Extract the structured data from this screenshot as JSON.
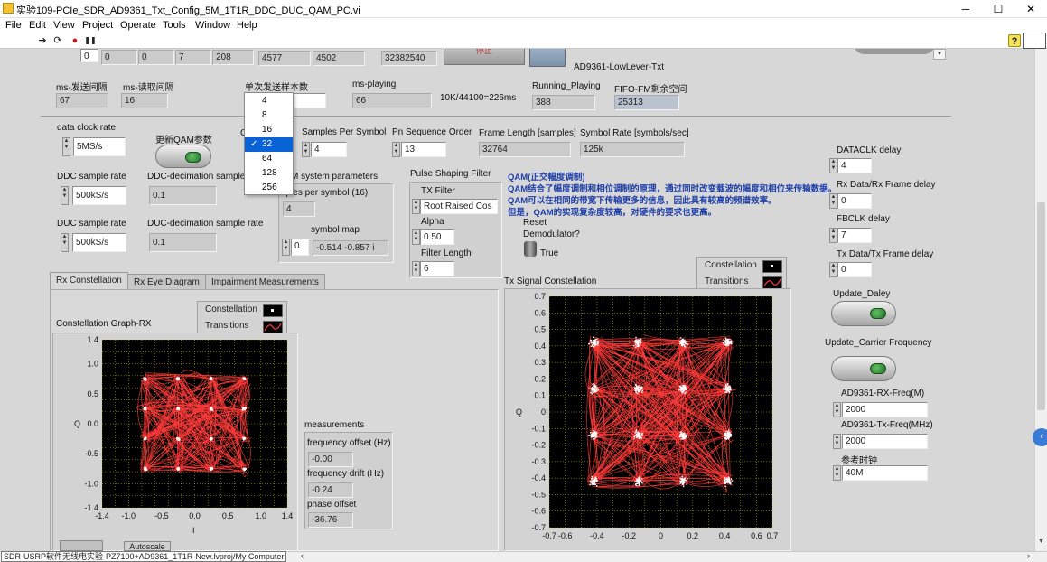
{
  "window": {
    "title": "实验109-PCIe_SDR_AD9361_Txt_Config_5M_1T1R_DDC_DUC_QAM_PC.vi",
    "minimize": "─",
    "maximize": "☐",
    "close": "✕"
  },
  "menu": [
    "File",
    "Edit",
    "View",
    "Project",
    "Operate",
    "Tools",
    "Window",
    "Help"
  ],
  "toolbar": {
    "run": "➔",
    "run_cont": "⟳",
    "abort": "●",
    "pause": "❚❚",
    "help": "?"
  },
  "top_row": {
    "v0": "0",
    "v1": "0",
    "v2": "0",
    "v3": "7",
    "v4": "208",
    "v5": "4577",
    "v6": "4502",
    "v7": "32382540",
    "button_text": "停止",
    "ad_label": "AD9361-LowLever-Txt"
  },
  "row2": {
    "ms_send_label": "ms-发送间隔",
    "ms_send": "67",
    "ms_read_label": "ms-读取间隔",
    "ms_read": "16",
    "single_samples_label": "单次发送样本数",
    "ms_playing_label": "ms-playing",
    "ms_playing": "66",
    "rate_note": "10K/44100=226ms",
    "running_label": "Running_Playing",
    "running": "388",
    "fifo_label": "FIFO-FM剩余空间",
    "fifo": "25313"
  },
  "dropdown": {
    "items": [
      "4",
      "8",
      "16",
      "32",
      "64",
      "128",
      "256"
    ],
    "selected_index": 3
  },
  "left": {
    "data_clock_label": "data clock rate",
    "data_clock": "5MS/s",
    "update_qam_label": "更新QAM参数",
    "ddc_label": "DDC sample rate",
    "ddc": "500kS/s",
    "ddc_dec_label": "DDC-decimation sample rate",
    "ddc_dec": "0.1",
    "duc_label": "DUC sample rate",
    "duc": "500kS/s",
    "duc_dec_label": "DUC-decimation sample rate",
    "duc_dec": "0.1",
    "c_fragment": "C"
  },
  "qam_params": {
    "sps_label": "Samples Per Symbol",
    "sps": "4",
    "pn_label": "Pn Sequence Order",
    "pn": "13",
    "frame_label": "Frame Length [samples]",
    "frame": "32764",
    "symrate_label": "Symbol Rate [symbols/sec]",
    "symrate": "125k",
    "sys_label": "M system parameters",
    "sps16_label": "nples per symbol (16)",
    "sps16": "4",
    "symmap_label": "symbol map",
    "symmap_idx": "0",
    "symmap": "-0.514 -0.857 i"
  },
  "pulse": {
    "title": "Pulse Shaping Filter",
    "tx_filter_label": "TX Filter",
    "tx_filter": "Root Raised Cos",
    "alpha_label": "Alpha",
    "alpha": "0.50",
    "flen_label": "Filter Length",
    "flen": "6"
  },
  "qam_desc": {
    "title": "QAM(正交幅度调制)",
    "line1": "QAM结合了幅度调制和相位调制的原理，通过同时改变载波的幅度和相位来传输数据。",
    "line2": "QAM可以在相同的带宽下传输更多的信息，因此具有较高的频谱效率。",
    "line3": "但是，QAM的实现复杂度较高，对硬件的要求也更高。"
  },
  "reset": {
    "label1": "Reset",
    "label2": "Demodulator?",
    "value": "True"
  },
  "tabs": [
    "Rx Constellation",
    "Rx Eye Diagram",
    "Impairment Measurements"
  ],
  "rx_graph": {
    "title": "Constellation Graph-RX",
    "legend_const": "Constellation",
    "legend_trans": "Transitions",
    "yaxis_label": "Q",
    "xaxis_label": "I",
    "x_ticks": [
      "-1.4",
      "-1.0",
      "-0.5",
      "0.0",
      "0.5",
      "1.0",
      "1.4"
    ],
    "y_ticks": [
      "1.4",
      "1.0",
      "0.5",
      "0.0",
      "-0.5",
      "-1.0",
      "-1.4"
    ],
    "autoscale": "Autoscale"
  },
  "measurements": {
    "title": "measurements",
    "freq_off_label": "frequency offset (Hz)",
    "freq_off": "-0.00",
    "freq_drift_label": "frequency drift (Hz)",
    "freq_drift": "-0.24",
    "phase_label": "phase offset",
    "phase": "-36.76"
  },
  "tx_graph": {
    "title": "Tx Signal Constellation",
    "legend_const": "Constellation",
    "legend_trans": "Transitions",
    "yaxis_label": "Q",
    "x_ticks": [
      "-0.7",
      "-0.6",
      "-0.4",
      "-0.2",
      "0",
      "0.2",
      "0.4",
      "0.6",
      "0.7"
    ],
    "y_ticks": [
      "0.7",
      "0.6",
      "0.5",
      "0.4",
      "0.3",
      "0.2",
      "0.1",
      "0",
      "-0.1",
      "-0.2",
      "-0.3",
      "-0.4",
      "-0.5",
      "-0.6",
      "-0.7"
    ]
  },
  "right": {
    "dataclk_label": "DATACLK delay",
    "dataclk": "4",
    "rxframe_label": "Rx Data/Rx Frame delay",
    "rxframe": "0",
    "fbclk_label": "FBCLK delay",
    "fbclk": "7",
    "txframe_label": "Tx Data/Tx Frame delay",
    "txframe": "0",
    "update_delay_label": "Update_Daley",
    "update_cf_label": "Update_Carrier Frequency",
    "rxfreq_label": "AD9361-RX-Freq(M)",
    "rxfreq": "2000",
    "txfreq_label": "AD9361-Tx-Freq(MHz)",
    "txfreq": "2000",
    "refclk_label": "参考时钟",
    "refclk": "40M"
  },
  "status": "SDR-USRP软件无线电实验-PZ7100+AD9361_1T1R-New.lvproj/My Computer",
  "colors": {
    "trace": "#ff3b3b",
    "points": "#ffffff",
    "grid": "#c8c800",
    "plot_bg": "#000000",
    "selection": "#0a63d6"
  }
}
